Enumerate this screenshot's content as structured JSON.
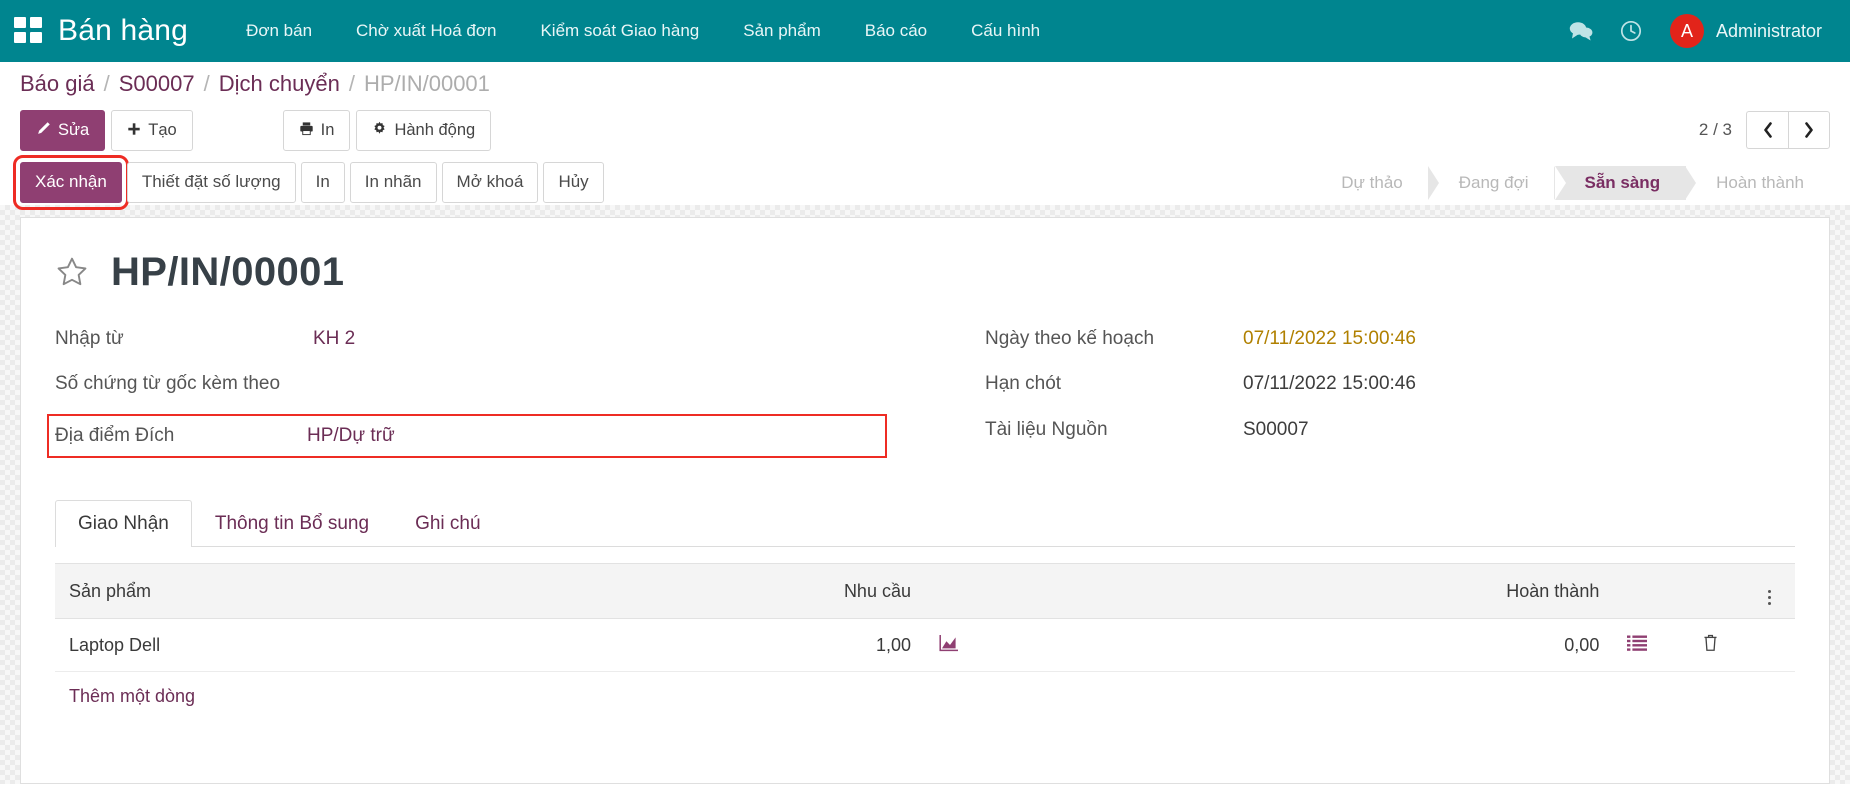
{
  "navbar": {
    "apps_icon": "apps-grid-icon",
    "brand": "Bán hàng",
    "menu": [
      {
        "label": "Đơn bán"
      },
      {
        "label": "Chờ xuất Hoá đơn"
      },
      {
        "label": "Kiểm soát Giao hàng"
      },
      {
        "label": "Sản phẩm"
      },
      {
        "label": "Báo cáo"
      },
      {
        "label": "Cấu hình"
      }
    ],
    "icons": [
      {
        "name": "messages-icon"
      },
      {
        "name": "activities-clock-icon"
      }
    ],
    "user": {
      "initial": "A",
      "name": "Administrator",
      "avatar_color": "#e2241a"
    },
    "bg_color": "#00858f"
  },
  "breadcrumb": {
    "items": [
      {
        "label": "Báo giá",
        "current": false
      },
      {
        "label": "S00007",
        "current": false
      },
      {
        "label": "Dịch chuyển",
        "current": false
      },
      {
        "label": "HP/IN/00001",
        "current": true
      }
    ],
    "separator": "/"
  },
  "control_panel": {
    "edit_label": "Sửa",
    "create_label": "Tạo",
    "print_label": "In",
    "action_label": "Hành động",
    "pager": {
      "text": "2 / 3",
      "prev": "‹",
      "next": "›"
    }
  },
  "status_buttons": [
    {
      "label": "Xác nhận",
      "primary": true,
      "highlighted": true
    },
    {
      "label": "Thiết đặt số lượng",
      "primary": false,
      "highlighted": false
    },
    {
      "label": "In",
      "primary": false,
      "highlighted": false
    },
    {
      "label": "In nhãn",
      "primary": false,
      "highlighted": false
    },
    {
      "label": "Mở khoá",
      "primary": false,
      "highlighted": false
    },
    {
      "label": "Hủy",
      "primary": false,
      "highlighted": false
    }
  ],
  "statusbar": {
    "stages": [
      {
        "label": "Dự thảo",
        "active": false
      },
      {
        "label": "Đang đợi",
        "active": false
      },
      {
        "label": "Sẵn sàng",
        "active": true
      },
      {
        "label": "Hoàn thành",
        "active": false
      }
    ],
    "active_color": "#7a2e63"
  },
  "form": {
    "title": "HP/IN/00001",
    "favorite_icon": "star-icon",
    "left_fields": [
      {
        "label": "Nhập từ",
        "value": "KH 2",
        "style": "link",
        "boxed": false
      },
      {
        "label": "Số chứng từ gốc kèm theo",
        "value": "",
        "style": "plain",
        "boxed": false
      },
      {
        "label": "Địa điểm Đích",
        "value": "HP/Dự trữ",
        "style": "link",
        "boxed": true
      }
    ],
    "right_fields": [
      {
        "label": "Ngày theo kế hoạch",
        "value": "07/11/2022 15:00:46",
        "style": "warn",
        "boxed": false
      },
      {
        "label": "Hạn chót",
        "value": "07/11/2022 15:00:46",
        "style": "plain",
        "boxed": false
      },
      {
        "label": "Tài liệu Nguồn",
        "value": "S00007",
        "style": "plain",
        "boxed": false
      }
    ],
    "highlight_color": "#ee2c24"
  },
  "tabs": [
    {
      "label": "Giao Nhận",
      "active": true
    },
    {
      "label": "Thông tin Bổ sung",
      "active": false
    },
    {
      "label": "Ghi chú",
      "active": false
    }
  ],
  "lines_table": {
    "headers": {
      "product": "Sản phẩm",
      "demand": "Nhu cầu",
      "done": "Hoàn thành",
      "options_icon": "vertical-dots-icon"
    },
    "rows": [
      {
        "product": "Laptop Dell",
        "demand": "1,00",
        "demand_icon": "forecast-chart-icon",
        "done": "0,00",
        "done_icon": "detailed-operations-icon",
        "delete_icon": "trash-icon"
      }
    ],
    "add_line_label": "Thêm một dòng"
  }
}
